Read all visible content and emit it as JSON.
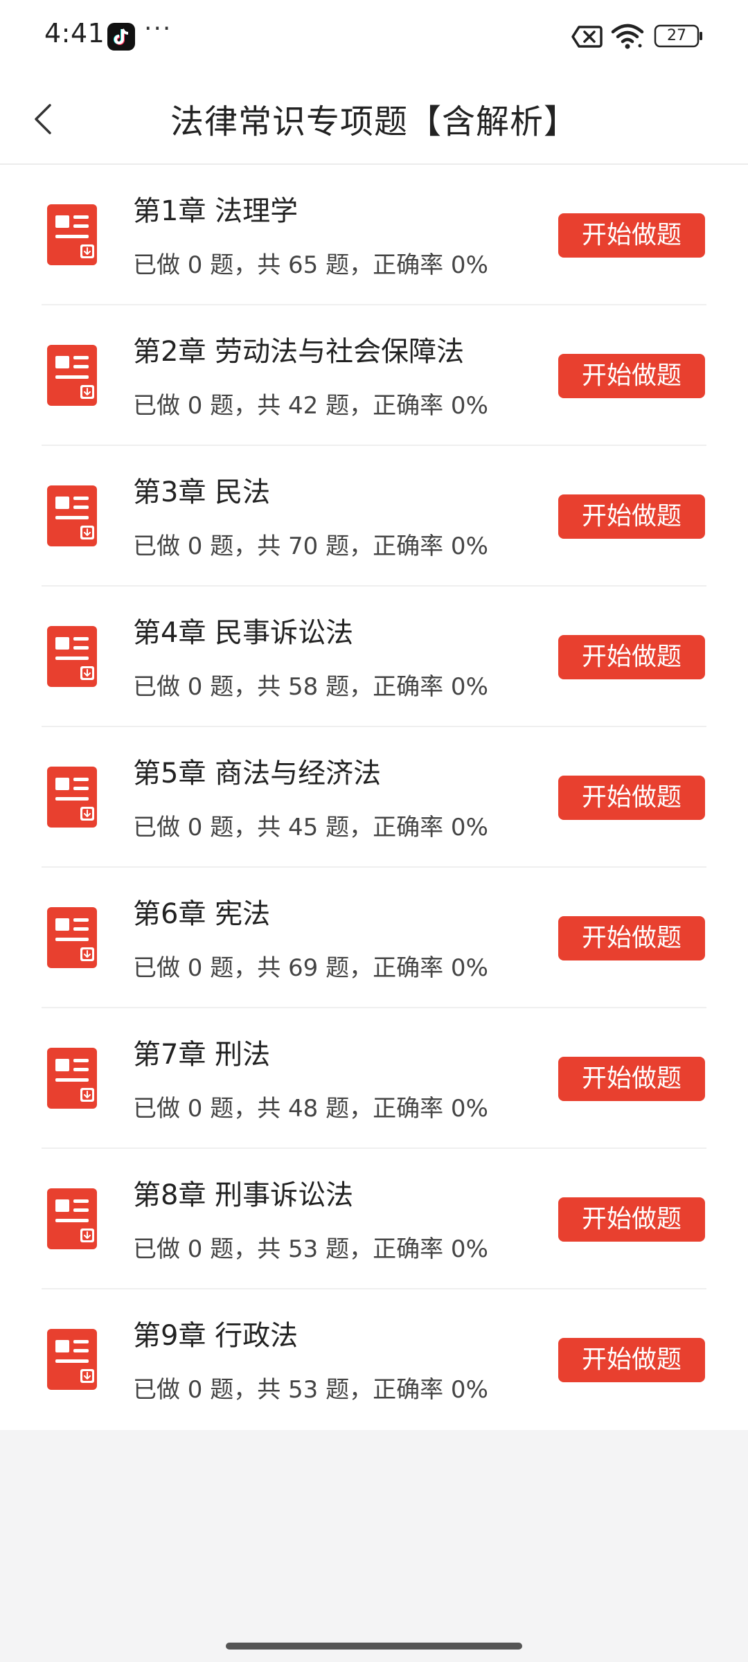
{
  "status_bar": {
    "time": "4:41",
    "more_dots": "···",
    "battery_level": "27",
    "icons": [
      "tiktok-icon",
      "no-sim-icon",
      "wifi-icon",
      "battery-icon"
    ]
  },
  "header": {
    "title": "法律常识专项题【含解析】",
    "back_icon": "chevron-left-icon"
  },
  "colors": {
    "accent": "#e8402f",
    "page_bg": "#f4f4f5",
    "card_bg": "#ffffff"
  },
  "chapters": [
    {
      "title": "第1章 法理学",
      "stats": "已做 0 题，共 65 题，正确率 0%",
      "done": 0,
      "total": 65,
      "accuracy": "0%",
      "button": "开始做题"
    },
    {
      "title": "第2章 劳动法与社会保障法",
      "stats": "已做 0 题，共 42 题，正确率 0%",
      "done": 0,
      "total": 42,
      "accuracy": "0%",
      "button": "开始做题"
    },
    {
      "title": "第3章 民法",
      "stats": "已做 0 题，共 70 题，正确率 0%",
      "done": 0,
      "total": 70,
      "accuracy": "0%",
      "button": "开始做题"
    },
    {
      "title": "第4章 民事诉讼法",
      "stats": "已做 0 题，共 58 题，正确率 0%",
      "done": 0,
      "total": 58,
      "accuracy": "0%",
      "button": "开始做题"
    },
    {
      "title": "第5章 商法与经济法",
      "stats": "已做 0 题，共 45 题，正确率 0%",
      "done": 0,
      "total": 45,
      "accuracy": "0%",
      "button": "开始做题"
    },
    {
      "title": "第6章 宪法",
      "stats": "已做 0 题，共 69 题，正确率 0%",
      "done": 0,
      "total": 69,
      "accuracy": "0%",
      "button": "开始做题"
    },
    {
      "title": "第7章 刑法",
      "stats": "已做 0 题，共 48 题，正确率 0%",
      "done": 0,
      "total": 48,
      "accuracy": "0%",
      "button": "开始做题"
    },
    {
      "title": "第8章 刑事诉讼法",
      "stats": "已做 0 题，共 53 题，正确率 0%",
      "done": 0,
      "total": 53,
      "accuracy": "0%",
      "button": "开始做题"
    },
    {
      "title": "第9章 行政法",
      "stats": "已做 0 题，共 53 题，正确率 0%",
      "done": 0,
      "total": 53,
      "accuracy": "0%",
      "button": "开始做题"
    }
  ]
}
